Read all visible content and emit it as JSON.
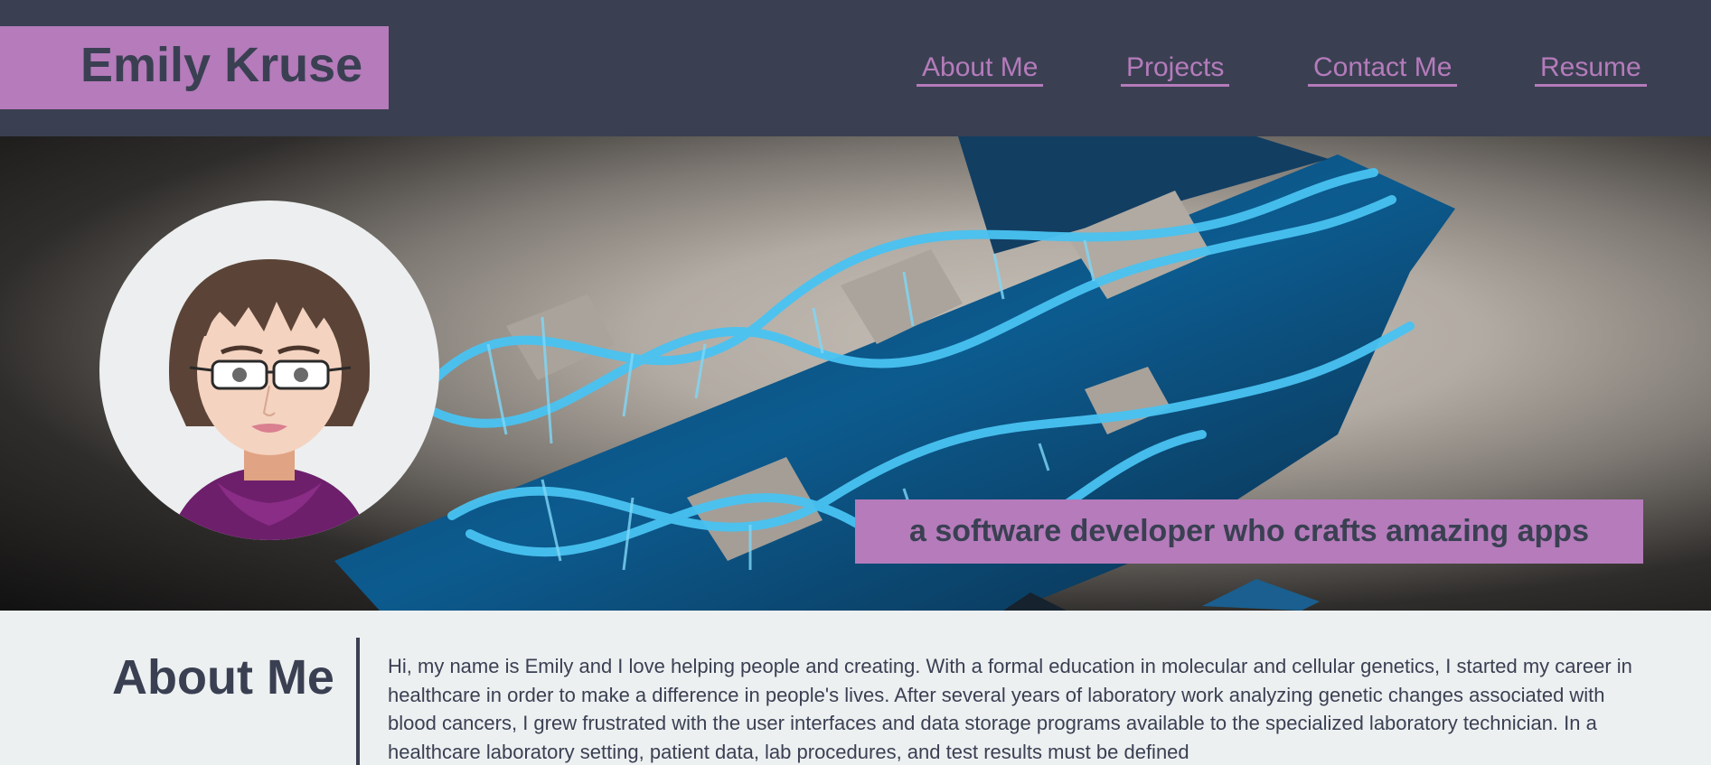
{
  "header": {
    "brand_name": "Emily Kruse",
    "nav": [
      {
        "label": "About Me"
      },
      {
        "label": "Projects"
      },
      {
        "label": "Contact Me"
      },
      {
        "label": "Resume"
      }
    ]
  },
  "hero": {
    "tagline": "a software developer who crafts amazing apps",
    "background_image": "dna-puzzle-image",
    "avatar": "avatar-illustration"
  },
  "about": {
    "heading": "About Me",
    "body": "Hi, my name is Emily and I love helping people and creating. With a formal education in molecular and cellular genetics, I started my career in healthcare in order to make a difference in people's lives. After several years of laboratory work analyzing genetic changes associated with blood cancers, I grew frustrated with the user interfaces and data storage programs available to the specialized laboratory technician. In a healthcare laboratory setting, patient data, lab procedures, and test results must be defined"
  },
  "colors": {
    "header_bg": "#3a4052",
    "accent": "#b57bbb",
    "text": "#3a4052",
    "page_bg": "#edf0f1"
  }
}
